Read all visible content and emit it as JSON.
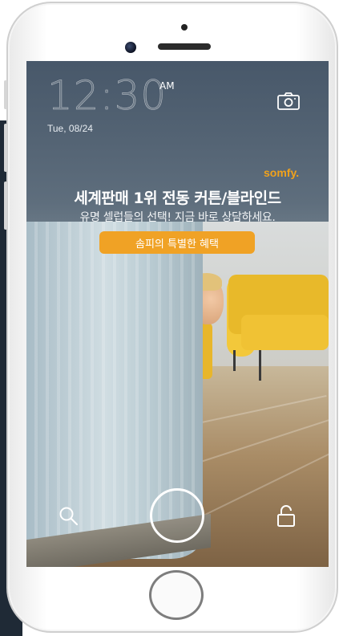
{
  "lockscreen": {
    "time": "12:30",
    "ampm": "AM",
    "date": "Tue, 08/24"
  },
  "ad": {
    "brand": "somfy.",
    "headline": "세계판매 1위 전동 커튼/블라인드",
    "subline": "유명 셀럽들의 선택! 지금 바로 상담하세요.",
    "cta_label": "솜피의 특별한 혜택",
    "accent_color": "#f0a225"
  },
  "icons": {
    "camera": "camera-icon",
    "search": "search-icon",
    "shutter": "circle-icon",
    "lock": "lock-icon"
  }
}
